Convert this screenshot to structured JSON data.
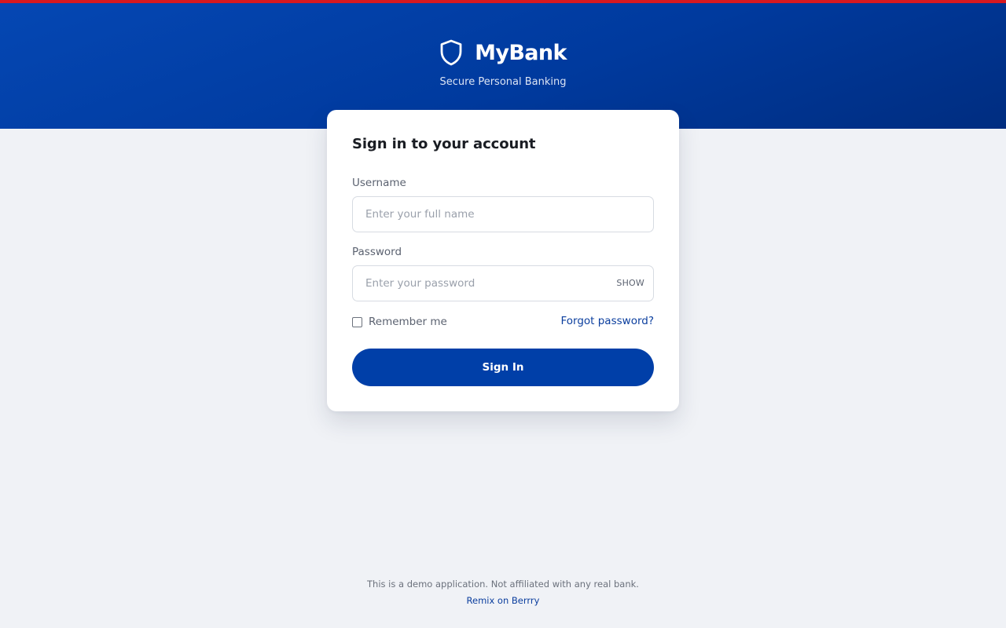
{
  "brand": {
    "name": "MyBank",
    "tagline": "Secure Personal Banking",
    "logo_icon": "shield-icon",
    "accent_color": "#d71920",
    "primary_color": "#003fa8"
  },
  "login_form": {
    "title": "Sign in to your account",
    "username": {
      "label": "Username",
      "placeholder": "Enter your full name",
      "value": ""
    },
    "password": {
      "label": "Password",
      "placeholder": "Enter your password",
      "value": "",
      "toggle_label": "SHOW"
    },
    "remember_me": {
      "label": "Remember me",
      "checked": false
    },
    "forgot_password": "Forgot password?",
    "submit_label": "Sign In"
  },
  "footer": {
    "disclaimer": "This is a demo application. Not affiliated with any real bank.",
    "link_text": "Remix on Berrry"
  }
}
